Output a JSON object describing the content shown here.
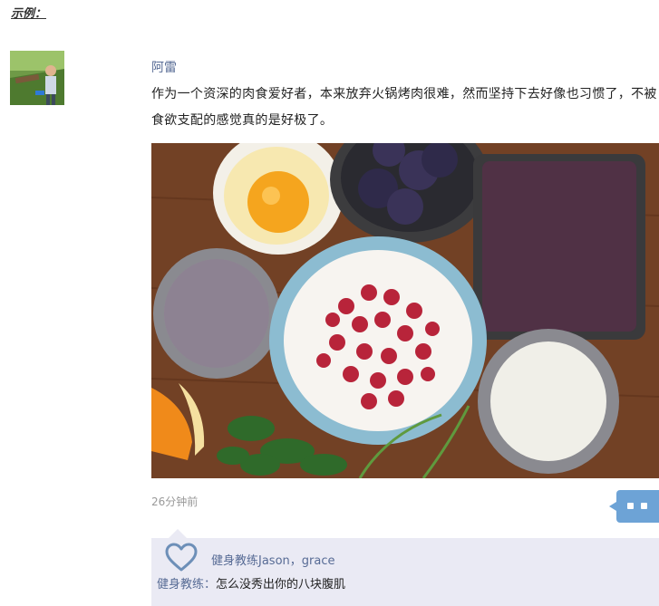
{
  "example_label": "示例：",
  "post": {
    "username": "阿雷",
    "text": "作为一个资深的肉食爱好者，本来放弃火锅烤肉很难，然而坚持下去好像也习惯了，不被食欲支配的感觉真的是好极了。",
    "timestamp": "26分钟前"
  },
  "likes": {
    "names": "健身教练Jason，grace"
  },
  "comments": [
    {
      "author": "健身教练：",
      "text": "怎么没秀出你的八块腹肌"
    }
  ],
  "icons": {
    "like": "heart-outline-icon",
    "comment": "comment-dots-icon"
  },
  "colors": {
    "link": "#576b95",
    "accent": "#6da3d6",
    "comment_bg": "#eaeaf4"
  }
}
